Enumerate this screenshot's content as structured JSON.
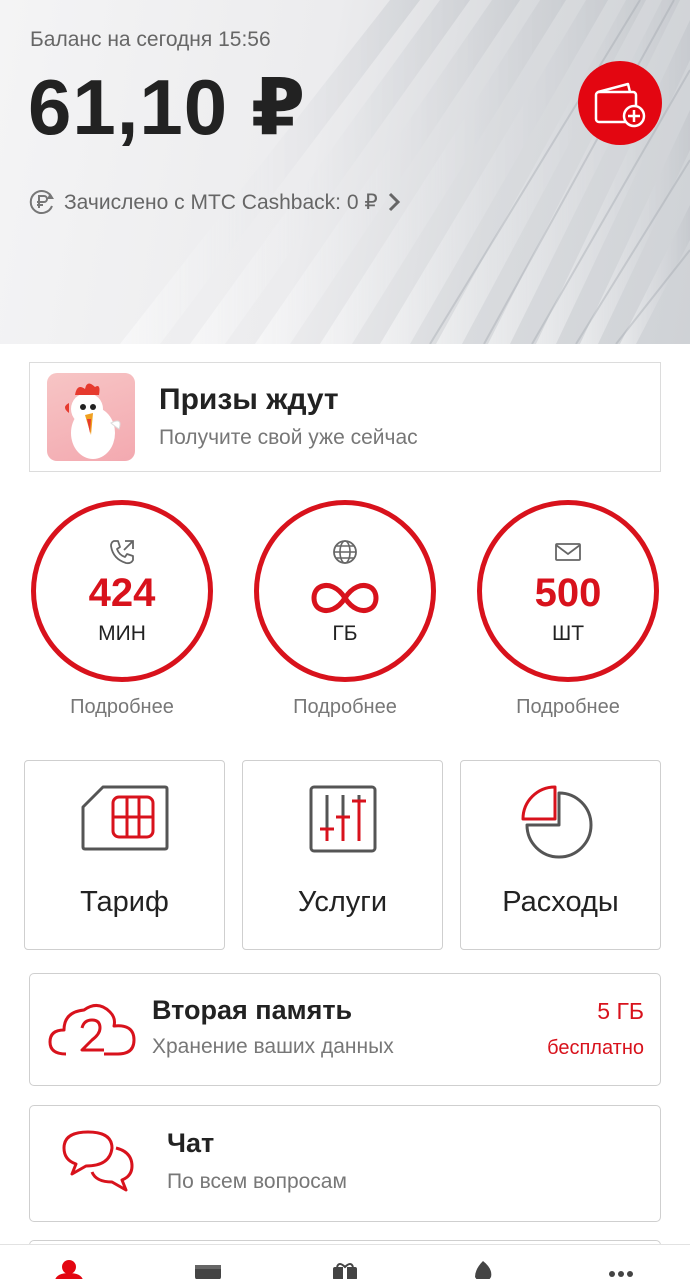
{
  "header": {
    "balance_caption": "Баланс на сегодня 15:56",
    "balance_amount": "61,10 ₽",
    "cashback_text": "Зачислено с МТС Cashback: 0 ₽",
    "topup_icon": "wallet-plus-icon"
  },
  "promo": {
    "title": "Призы ждут",
    "subtitle": "Получите свой уже сейчас"
  },
  "counters": [
    {
      "icon": "phone-icon",
      "value": "424",
      "unit": "МИН",
      "more": "Подробнее"
    },
    {
      "icon": "globe-icon",
      "value": "∞",
      "unit": "ГБ",
      "more": "Подробнее"
    },
    {
      "icon": "envelope-icon",
      "value": "500",
      "unit": "ШТ",
      "more": "Подробнее"
    }
  ],
  "tiles": [
    {
      "icon": "sim-card-icon",
      "label": "Тариф"
    },
    {
      "icon": "sliders-icon",
      "label": "Услуги"
    },
    {
      "icon": "pie-chart-icon",
      "label": "Расходы"
    }
  ],
  "cards": {
    "cloud": {
      "icon": "cloud-2-icon",
      "title": "Вторая память",
      "subtitle": "Хранение ваших данных",
      "badge_value": "5 ГБ",
      "badge_note": "бесплатно"
    },
    "chat": {
      "icon": "chat-bubbles-icon",
      "title": "Чат",
      "subtitle": "По всем вопросам"
    }
  },
  "nav": [
    "profile-icon",
    "wallet-icon",
    "gift-icon",
    "flame-icon",
    "more-dots-icon"
  ],
  "colors": {
    "accent": "#e30611",
    "accent_dark": "#d8121c",
    "text": "#222222",
    "muted": "#777777"
  }
}
